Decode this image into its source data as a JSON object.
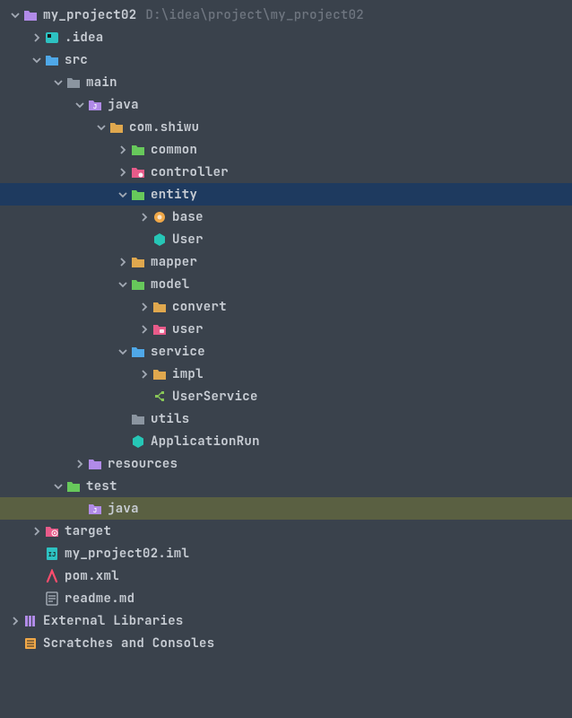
{
  "colors": {
    "chevron": "#a3aab5",
    "folderPurple": "#b18be8",
    "folderTeal": "#2dc2c2",
    "folderGray": "#8b95a0",
    "folderOrange": "#e0a84e",
    "folderGreen": "#67c85b",
    "folderMagenta": "#e85b8a",
    "folderBlue": "#4fa8e8",
    "classTeal": "#26c6b6",
    "interfaceGreen": "#88c757",
    "maven": "#ff4d6d",
    "file": "#aeb6c0",
    "pkgOrange": "#f0a848"
  },
  "tree": [
    {
      "depth": 0,
      "arrow": "down",
      "iconType": "folder",
      "iconColor": "folderPurple",
      "label": "my_project02",
      "suffixPath": "D:\\idea\\project\\my_project02",
      "name": "root-project"
    },
    {
      "depth": 1,
      "arrow": "right",
      "iconType": "idea",
      "iconColor": "folderTeal",
      "label": ".idea",
      "name": "node-idea"
    },
    {
      "depth": 1,
      "arrow": "down",
      "iconType": "source",
      "iconColor": "folderBlue",
      "label": "src",
      "name": "node-src"
    },
    {
      "depth": 2,
      "arrow": "down",
      "iconType": "folder",
      "iconColor": "folderGray",
      "label": "main",
      "name": "node-main"
    },
    {
      "depth": 3,
      "arrow": "down",
      "iconType": "javaFolder",
      "iconColor": "folderPurple",
      "label": "java",
      "name": "node-java-main"
    },
    {
      "depth": 4,
      "arrow": "down",
      "iconType": "folder",
      "iconColor": "folderOrange",
      "label": "com.shiwu",
      "name": "node-com-shiwu"
    },
    {
      "depth": 5,
      "arrow": "right",
      "iconType": "folder",
      "iconColor": "folderGreen",
      "label": "common",
      "name": "node-common"
    },
    {
      "depth": 5,
      "arrow": "right",
      "iconType": "gearFolder",
      "iconColor": "folderMagenta",
      "label": "controller",
      "name": "node-controller"
    },
    {
      "depth": 5,
      "arrow": "down",
      "iconType": "folder",
      "iconColor": "folderGreen",
      "label": "entity",
      "name": "node-entity",
      "state": "selected"
    },
    {
      "depth": 6,
      "arrow": "right",
      "iconType": "pkg",
      "iconColor": "pkgOrange",
      "label": "base",
      "name": "node-base"
    },
    {
      "depth": 6,
      "arrow": "none",
      "iconType": "class",
      "iconColor": "classTeal",
      "label": "User",
      "name": "node-user-class"
    },
    {
      "depth": 5,
      "arrow": "right",
      "iconType": "folder",
      "iconColor": "folderOrange",
      "label": "mapper",
      "name": "node-mapper"
    },
    {
      "depth": 5,
      "arrow": "down",
      "iconType": "folder",
      "iconColor": "folderGreen",
      "label": "model",
      "name": "node-model"
    },
    {
      "depth": 6,
      "arrow": "right",
      "iconType": "folder",
      "iconColor": "folderOrange",
      "label": "convert",
      "name": "node-convert"
    },
    {
      "depth": 6,
      "arrow": "right",
      "iconType": "robotFolder",
      "iconColor": "folderMagenta",
      "label": "user",
      "name": "node-user-pkg"
    },
    {
      "depth": 5,
      "arrow": "down",
      "iconType": "folder",
      "iconColor": "folderBlue",
      "label": "service",
      "name": "node-service"
    },
    {
      "depth": 6,
      "arrow": "right",
      "iconType": "folder",
      "iconColor": "folderOrange",
      "label": "impl",
      "name": "node-impl"
    },
    {
      "depth": 6,
      "arrow": "none",
      "iconType": "interface",
      "iconColor": "interfaceGreen",
      "label": "UserService",
      "name": "node-userservice"
    },
    {
      "depth": 5,
      "arrow": "none",
      "iconType": "folder",
      "iconColor": "folderGray",
      "label": "utils",
      "name": "node-utils"
    },
    {
      "depth": 5,
      "arrow": "none",
      "iconType": "class",
      "iconColor": "classTeal",
      "label": "ApplicationRun",
      "name": "node-applicationrun"
    },
    {
      "depth": 3,
      "arrow": "right",
      "iconType": "folder",
      "iconColor": "folderPurple",
      "label": "resources",
      "name": "node-resources"
    },
    {
      "depth": 2,
      "arrow": "down",
      "iconType": "folder",
      "iconColor": "folderGreen",
      "label": "test",
      "name": "node-test"
    },
    {
      "depth": 3,
      "arrow": "none",
      "iconType": "javaFolder",
      "iconColor": "folderPurple",
      "label": "java",
      "name": "node-java-test",
      "state": "context"
    },
    {
      "depth": 1,
      "arrow": "right",
      "iconType": "targetFolder",
      "iconColor": "folderMagenta",
      "label": "target",
      "name": "node-target"
    },
    {
      "depth": 1,
      "arrow": "none",
      "iconType": "iml",
      "iconColor": "folderTeal",
      "label": "my_project02.iml",
      "name": "node-iml"
    },
    {
      "depth": 1,
      "arrow": "none",
      "iconType": "maven",
      "iconColor": "maven",
      "label": "pom.xml",
      "name": "node-pom"
    },
    {
      "depth": 1,
      "arrow": "none",
      "iconType": "md",
      "iconColor": "file",
      "label": "readme.md",
      "name": "node-readme"
    },
    {
      "depth": 0,
      "arrow": "right",
      "iconType": "library",
      "iconColor": "folderPurple",
      "label": "External Libraries",
      "name": "node-external-libs"
    },
    {
      "depth": 0,
      "arrow": "none",
      "iconType": "scratch",
      "iconColor": "pkgOrange",
      "label": "Scratches and Consoles",
      "name": "node-scratches"
    }
  ]
}
